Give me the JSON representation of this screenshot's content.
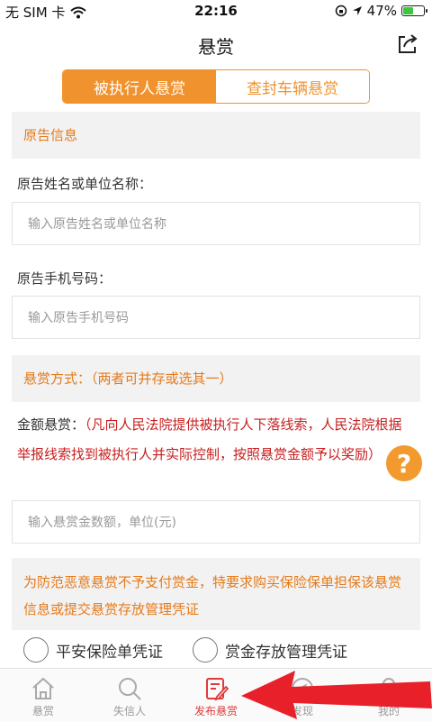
{
  "status_bar": {
    "carrier": "无 SIM 卡",
    "time": "22:16",
    "battery": "47%"
  },
  "nav": {
    "title": "悬赏"
  },
  "segments": {
    "active": "被执行人悬赏",
    "inactive": "查封车辆悬赏"
  },
  "sections": {
    "plaintiff_header": "原告信息",
    "reward_method_header": "悬赏方式：（两者可并存或选其一）"
  },
  "fields": {
    "name_label": "原告姓名或单位名称：",
    "name_placeholder": "输入原告姓名或单位名称",
    "phone_label": "原告手机号码：",
    "phone_placeholder": "输入原告手机号码",
    "amount_placeholder": "输入悬赏金数额，单位(元)"
  },
  "amount_note": {
    "label": "金额悬赏：",
    "text": "（凡向人民法院提供被执行人下落线索，人民法院根据举报线索找到被执行人并实际控制，按照悬赏金额予以奖励）"
  },
  "help_button": {
    "label": "?"
  },
  "notice": {
    "text": "为防范恶意悬赏不予支付赏金，特要求购买保险保单担保该悬赏信息或提交悬赏存放管理凭证"
  },
  "options": [
    "平安保险单凭证",
    "赏金存放管理凭证"
  ],
  "tabs": [
    {
      "label": "悬赏",
      "icon": "home-icon"
    },
    {
      "label": "失信人",
      "icon": "search-icon"
    },
    {
      "label": "发布悬赏",
      "icon": "edit-icon"
    },
    {
      "label": "发现",
      "icon": "compass-icon"
    },
    {
      "label": "我的",
      "icon": "person-icon"
    }
  ],
  "colors": {
    "accent": "#f0922e",
    "active_tab": "#e03a3a",
    "red_text": "#c81e1e",
    "arrow": "#e8202a"
  }
}
